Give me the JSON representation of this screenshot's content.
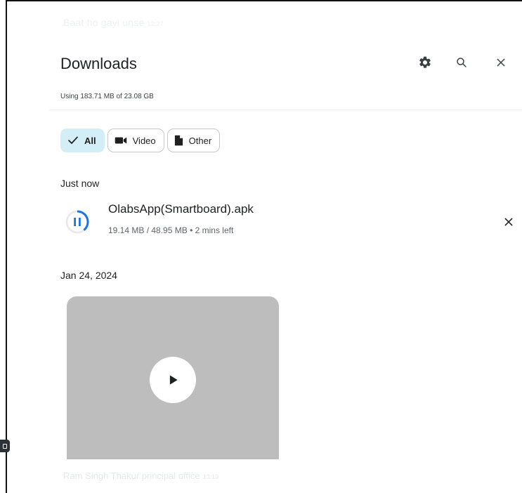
{
  "background_overlay": {
    "top_text": "Baat ho gayi unse",
    "top_time": "12:27",
    "bottom_text": "Ram Singh Thakur principal office",
    "bottom_time": "13:19"
  },
  "header": {
    "title": "Downloads",
    "storage_text": "Using 183.71 MB of 23.08 GB",
    "icons": [
      "gear-icon",
      "search-icon",
      "close-icon"
    ]
  },
  "filters": [
    {
      "label": "All",
      "icon": "check-icon",
      "selected": true
    },
    {
      "label": "Video",
      "icon": "video-icon",
      "selected": false
    },
    {
      "label": "Other",
      "icon": "file-icon",
      "selected": false
    }
  ],
  "sections": [
    {
      "heading": "Just now",
      "items": [
        {
          "name": "OlabsApp(Smartboard).apk",
          "meta": "19.14 MB / 48.95 MB • 2 mins left",
          "status": "paused",
          "progress": 0.391,
          "icon": "pause-progress-icon"
        }
      ]
    },
    {
      "heading": "Jan 24, 2024",
      "items": [
        {
          "type": "video",
          "icon": "play-icon"
        }
      ]
    }
  ],
  "colors": {
    "accent": "#1a73e8",
    "chip_selected_bg": "#d3eef7",
    "thumbnail_bg": "#bdbdbd"
  }
}
